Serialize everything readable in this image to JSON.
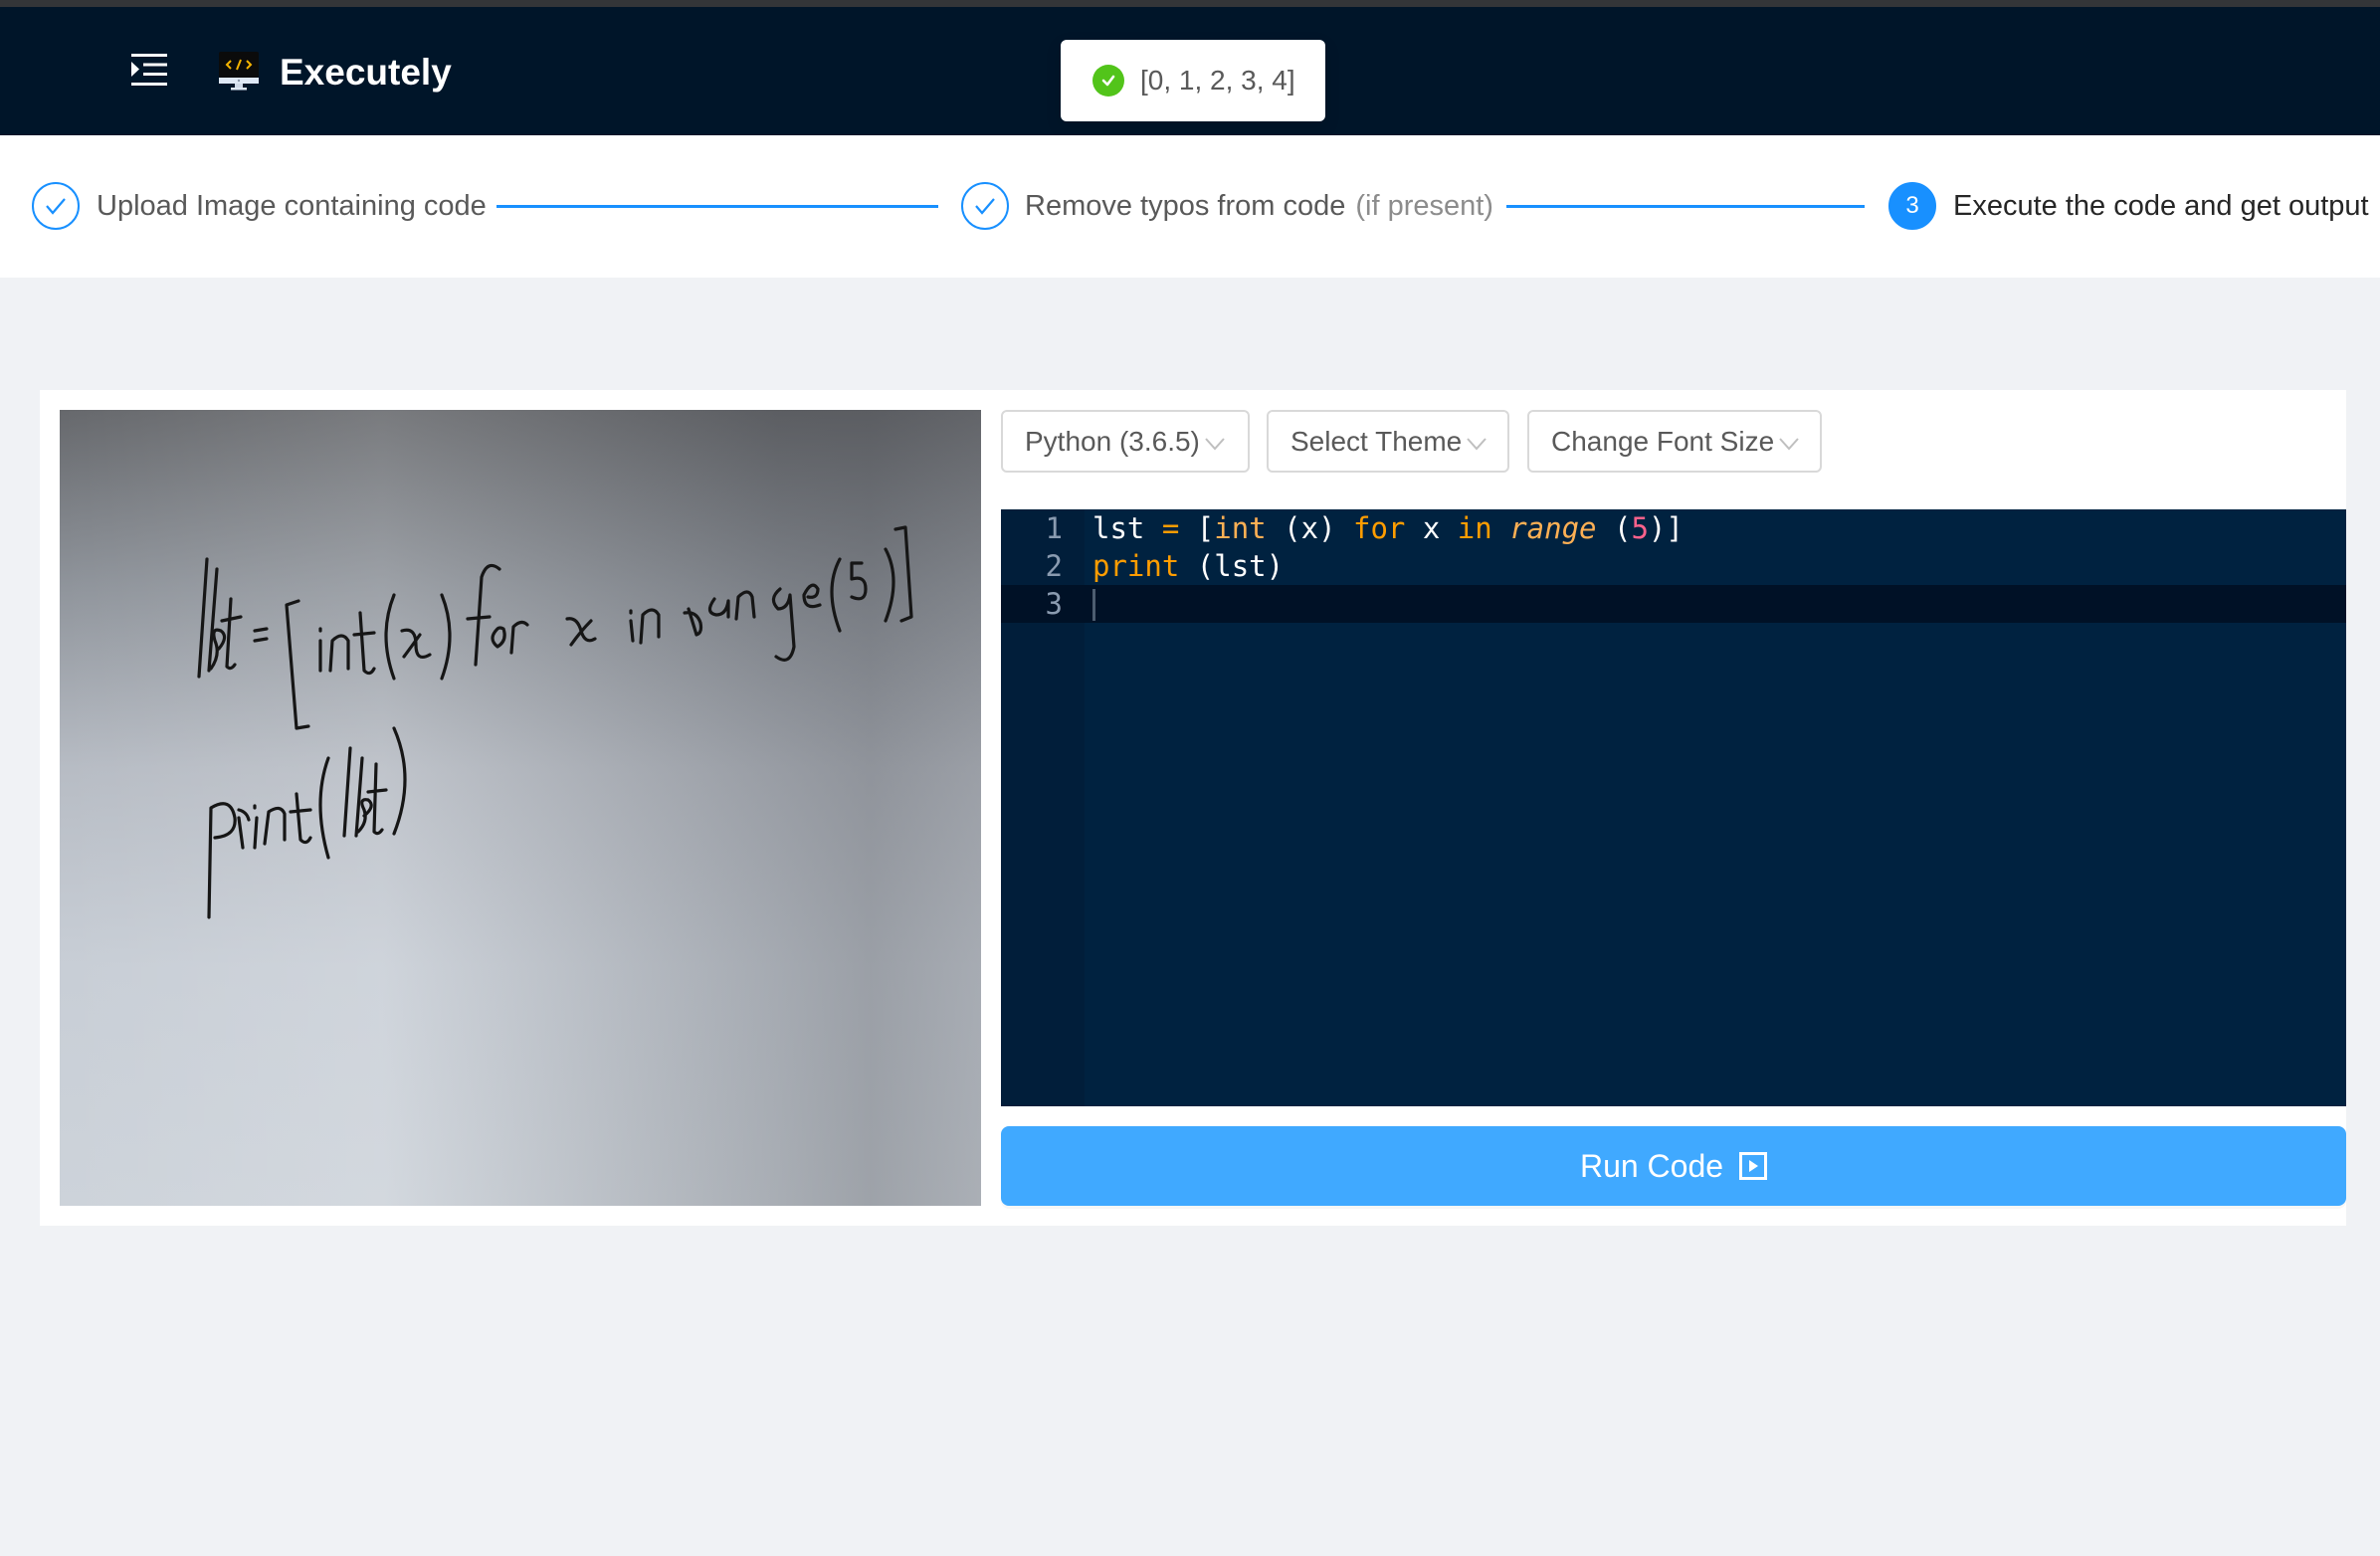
{
  "header": {
    "app_title": "Executely",
    "menu_icon": "menu-unfold-icon",
    "logo_icon": "monitor-code-icon"
  },
  "toast": {
    "icon": "check-circle-icon",
    "message": "[0, 1, 2, 3, 4]",
    "status_color": "#52c41a"
  },
  "stepper": {
    "accent_color": "#1890ff",
    "steps": [
      {
        "number": "1",
        "label": "Upload Image containing code",
        "description": "",
        "status": "finished"
      },
      {
        "number": "2",
        "label": "Remove typos from code",
        "description": "(if present)",
        "status": "finished"
      },
      {
        "number": "3",
        "label": "Execute the code and get output",
        "description": "",
        "status": "active"
      }
    ]
  },
  "main": {
    "image": {
      "alt": "Handwritten code on whiteboard",
      "handwritten_lines": [
        "lst = [int(x) for x in range(5)]",
        "print(lst)"
      ]
    },
    "toolbar": {
      "language": "Python (3.6.5)",
      "theme": "Select Theme",
      "font_size": "Change Font Size"
    },
    "editor": {
      "background": "#002240",
      "active_line": 3,
      "lines": [
        {
          "number": "1",
          "text": "lst = [int (x) for x in range (5)]"
        },
        {
          "number": "2",
          "text": "print (lst)"
        },
        {
          "number": "3",
          "text": ""
        }
      ]
    },
    "run_button": {
      "label": "Run Code",
      "icon": "play-square-icon",
      "color": "#40a9ff"
    }
  }
}
